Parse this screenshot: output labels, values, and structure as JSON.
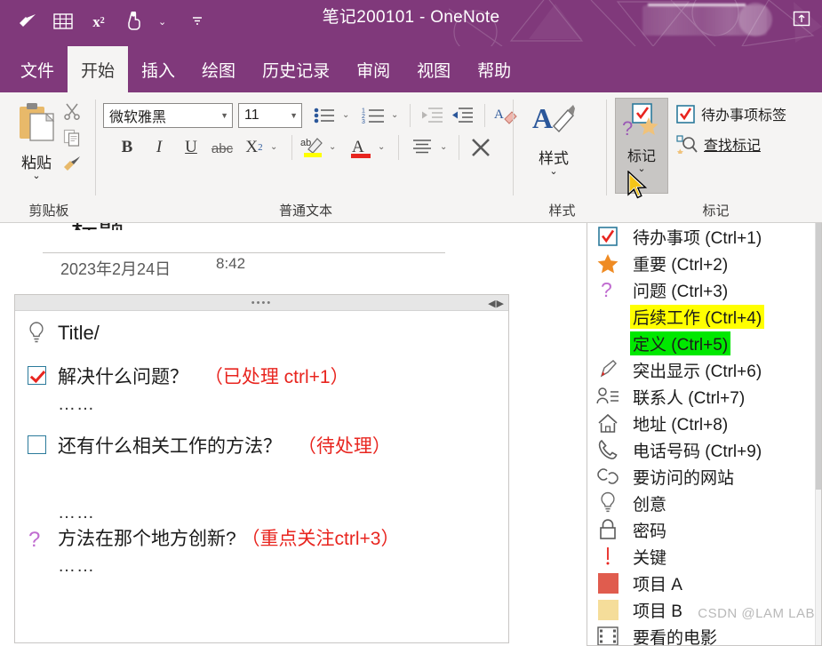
{
  "titlebar": {
    "title": "笔记200101  -  OneNote",
    "brand_color": "#80397b",
    "quick_access": [
      {
        "name": "format-painter-icon",
        "label": "格式刷"
      },
      {
        "name": "table-icon",
        "label": "表格"
      },
      {
        "name": "superscript-icon",
        "label": "x²"
      },
      {
        "name": "touch-mode-icon",
        "label": "触摸/鼠标模式"
      },
      {
        "name": "chevron-down-icon",
        "label": "自定义快速访问工具栏"
      },
      {
        "name": "ribbon-display-options-icon",
        "label": "功能区显示选项"
      }
    ],
    "restore_label": "还原"
  },
  "tabs": [
    {
      "label": "文件",
      "active": false
    },
    {
      "label": "开始",
      "active": true
    },
    {
      "label": "插入",
      "active": false
    },
    {
      "label": "绘图",
      "active": false
    },
    {
      "label": "历史记录",
      "active": false
    },
    {
      "label": "审阅",
      "active": false
    },
    {
      "label": "视图",
      "active": false
    },
    {
      "label": "帮助",
      "active": false
    }
  ],
  "ribbon": {
    "groups": [
      {
        "name": "clipboard",
        "label": "剪贴板"
      },
      {
        "name": "basic-text",
        "label": "普通文本"
      },
      {
        "name": "styles",
        "label": "样式"
      },
      {
        "name": "tags",
        "label": "标记"
      }
    ],
    "clipboard": {
      "paste_label": "粘贴",
      "cut_label": "剪切",
      "copy_label": "复制",
      "format_painter_label": "格式刷"
    },
    "basic_text": {
      "font_name": "微软雅黑",
      "font_size": "11",
      "bold": "B",
      "italic": "I",
      "underline": "U",
      "strikethrough": "abc",
      "subscript": "X",
      "subscript_sub": "2",
      "highlight_label": "ab",
      "font_color_label": "A",
      "highlight_color": "#ffff00",
      "font_color": "#e8251f",
      "align_label": "对齐",
      "clear_format_label": "删除格式",
      "bullets_label": "项目符号",
      "numbering_label": "编号",
      "decrease_indent_label": "减少缩进量",
      "increase_indent_label": "增加缩进量"
    },
    "styles": {
      "button_label": "样式"
    },
    "tags": {
      "button_label": "标记",
      "todo_tag_label": "待办事项标签",
      "find_tags_label": "查找标记"
    }
  },
  "tag_menu": {
    "items": [
      {
        "icon": "checkbox-icon",
        "label": "待办事项 (Ctrl+1)",
        "highlight": "none"
      },
      {
        "icon": "star-icon",
        "label": "重要 (Ctrl+2)",
        "highlight": "none"
      },
      {
        "icon": "question-mark-icon",
        "label": "问题 (Ctrl+3)",
        "highlight": "none"
      },
      {
        "icon": "none-icon",
        "label": "后续工作 (Ctrl+4)",
        "highlight": "yellow"
      },
      {
        "icon": "none-icon",
        "label": "定义 (Ctrl+5)",
        "highlight": "green"
      },
      {
        "icon": "pen-icon",
        "label": "突出显示 (Ctrl+6)",
        "highlight": "none"
      },
      {
        "icon": "contact-icon",
        "label": "联系人 (Ctrl+7)",
        "highlight": "none"
      },
      {
        "icon": "home-icon",
        "label": "地址 (Ctrl+8)",
        "highlight": "none"
      },
      {
        "icon": "phone-icon",
        "label": "电话号码 (Ctrl+9)",
        "highlight": "none"
      },
      {
        "icon": "link-icon",
        "label": "要访问的网站",
        "highlight": "none"
      },
      {
        "icon": "lightbulb-icon",
        "label": "创意",
        "highlight": "none"
      },
      {
        "icon": "lock-icon",
        "label": "密码",
        "highlight": "none"
      },
      {
        "icon": "exclamation-icon",
        "label": "关键",
        "highlight": "none"
      },
      {
        "icon": "swatch-red-icon",
        "label": "项目 A",
        "highlight": "none",
        "color": "#e05c4e"
      },
      {
        "icon": "swatch-yellow-icon",
        "label": "项目 B",
        "highlight": "none",
        "color": "#f5dd9a"
      },
      {
        "icon": "film-icon",
        "label": "要看的电影",
        "highlight": "none"
      }
    ]
  },
  "page": {
    "title_clipped": "标题",
    "date": "2023年2月24日",
    "time": "8:42",
    "note": {
      "title": "Title/",
      "rows": [
        {
          "kind": "title",
          "icon": "lightbulb-icon",
          "text": "Title/",
          "annotation": ""
        },
        {
          "kind": "checked",
          "icon": "checkbox-checked-icon",
          "text": "解决什么问题？",
          "annotation": "（已处理 ctrl+1）"
        },
        {
          "kind": "dots",
          "icon": "none-icon",
          "text": "……",
          "annotation": ""
        },
        {
          "kind": "unchecked",
          "icon": "checkbox-icon",
          "text": "还有什么相关工作的方法？",
          "annotation": "（待处理）"
        },
        {
          "kind": "dots",
          "icon": "none-icon",
          "text": "……",
          "annotation": ""
        },
        {
          "kind": "question",
          "icon": "question-mark-icon",
          "text": "方法在那个地方创新?",
          "annotation": "（重点关注ctrl+3）"
        },
        {
          "kind": "dots",
          "icon": "none-icon",
          "text": "……",
          "annotation": ""
        }
      ]
    }
  },
  "watermark": "CSDN @LAM LAB"
}
